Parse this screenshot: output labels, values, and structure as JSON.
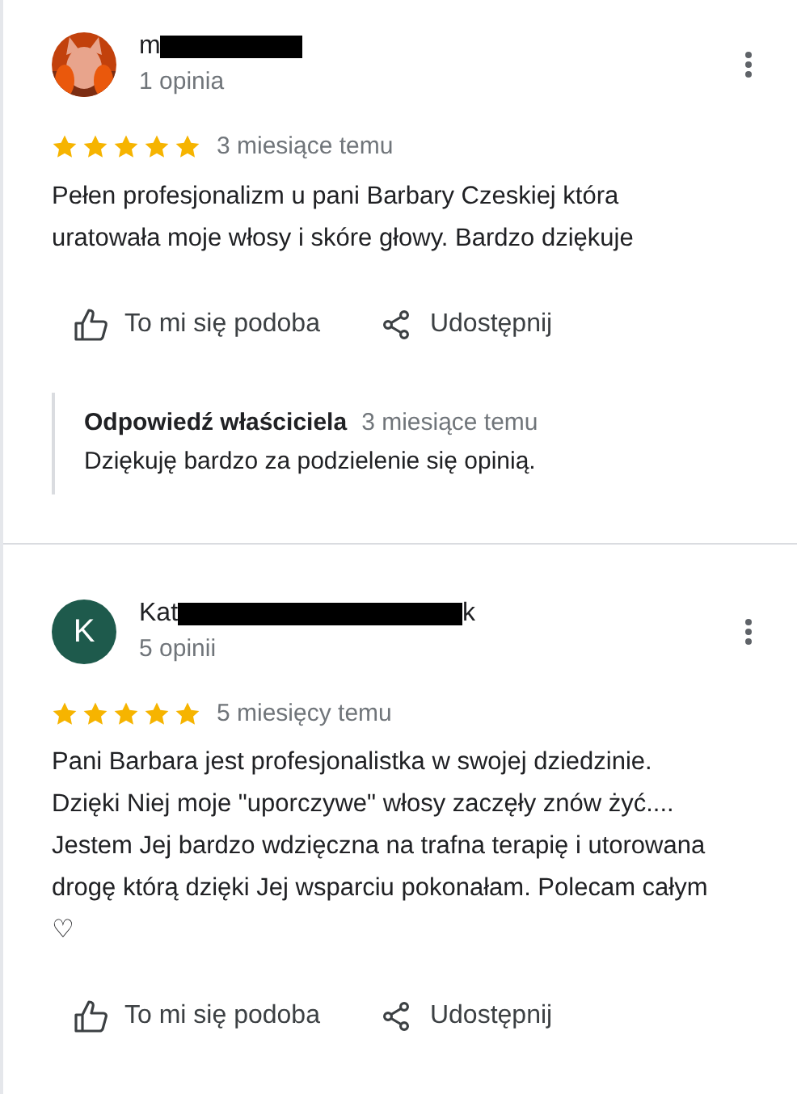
{
  "reviews": [
    {
      "author": {
        "visible_start": "m"
      },
      "review_count": "1 opinia",
      "stars": 5,
      "date": "3 miesiące temu",
      "text": "Pełen profesjonalizm u pani Barbary Czeskiej która uratowała moje włosy i skóre głowy. Bardzo dziękuje",
      "like_label": "To mi się podoba",
      "share_label": "Udostępnij",
      "owner_reply": {
        "title": "Odpowiedź właściciela",
        "date": "3 miesiące temu",
        "text": "Dziękuję bardzo za podzielenie się opinią."
      }
    },
    {
      "author": {
        "visible_start": "Kat",
        "visible_end": "k",
        "avatar": {
          "kind": "initial",
          "initial": "K",
          "color": "#1e5a4c"
        }
      },
      "review_count": "5 opinii",
      "stars": 5,
      "date": "5 miesięcy temu",
      "text": "Pani Barbara jest profesjonalistka w swojej dziedzinie. Dzięki Niej moje \"uporczywe\" włosy zaczęły znów żyć.... Jestem Jej bardzo wdzięczna na trafna terapię i utorowana drogę którą dzięki Jej wsparciu pokonałam. Polecam całym ♡",
      "like_label": "To mi się podoba",
      "share_label": "Udostępnij"
    }
  ]
}
